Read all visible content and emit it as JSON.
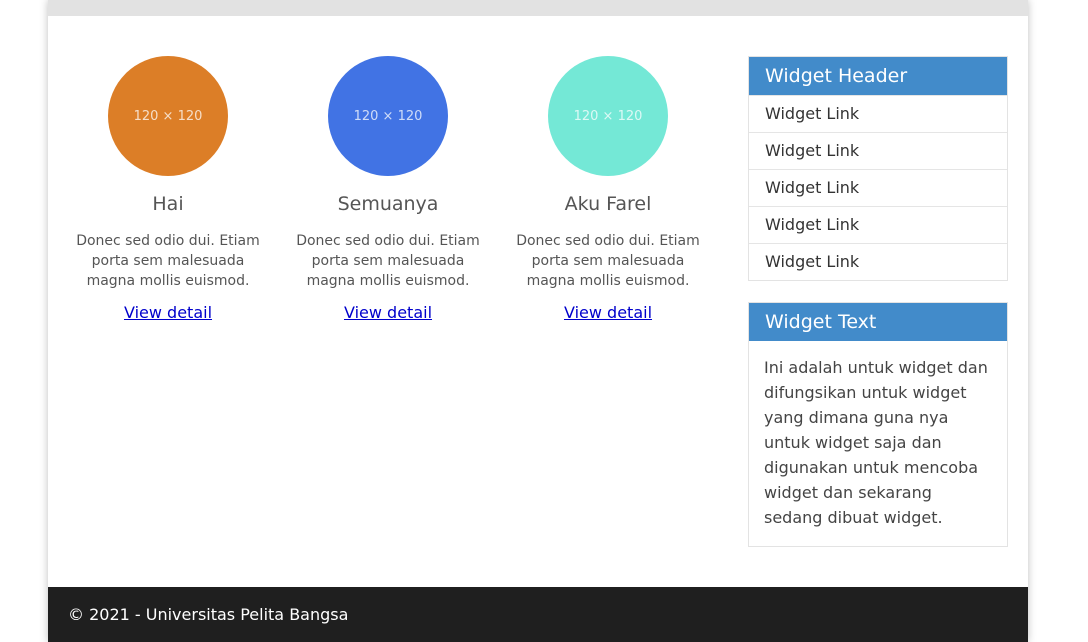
{
  "colors": {
    "avatar_1": "#dc7e27",
    "avatar_2": "#4173e4",
    "avatar_3": "#74e8d6",
    "widget_header": "#428bca",
    "footer_bg": "#1f1f1f"
  },
  "cards": [
    {
      "placeholder": "120 × 120",
      "title": "Hai",
      "desc": "Donec sed odio dui. Etiam porta sem malesuada magna mollis euismod.",
      "link": "View detail"
    },
    {
      "placeholder": "120 × 120",
      "title": "Semuanya",
      "desc": "Donec sed odio dui. Etiam porta sem malesuada magna mollis euismod.",
      "link": "View detail"
    },
    {
      "placeholder": "120 × 120",
      "title": "Aku Farel",
      "desc": "Donec sed odio dui. Etiam porta sem malesuada magna mollis euismod.",
      "link": "View detail"
    }
  ],
  "widget_links": {
    "header": "Widget Header",
    "items": [
      "Widget Link",
      "Widget Link",
      "Widget Link",
      "Widget Link",
      "Widget Link"
    ]
  },
  "widget_text": {
    "header": "Widget Text",
    "body": "Ini adalah untuk widget dan difungsikan untuk widget yang dimana guna nya untuk widget saja dan digunakan untuk mencoba widget dan sekarang sedang dibuat widget."
  },
  "footer": {
    "text": "© 2021 - Universitas Pelita Bangsa"
  }
}
